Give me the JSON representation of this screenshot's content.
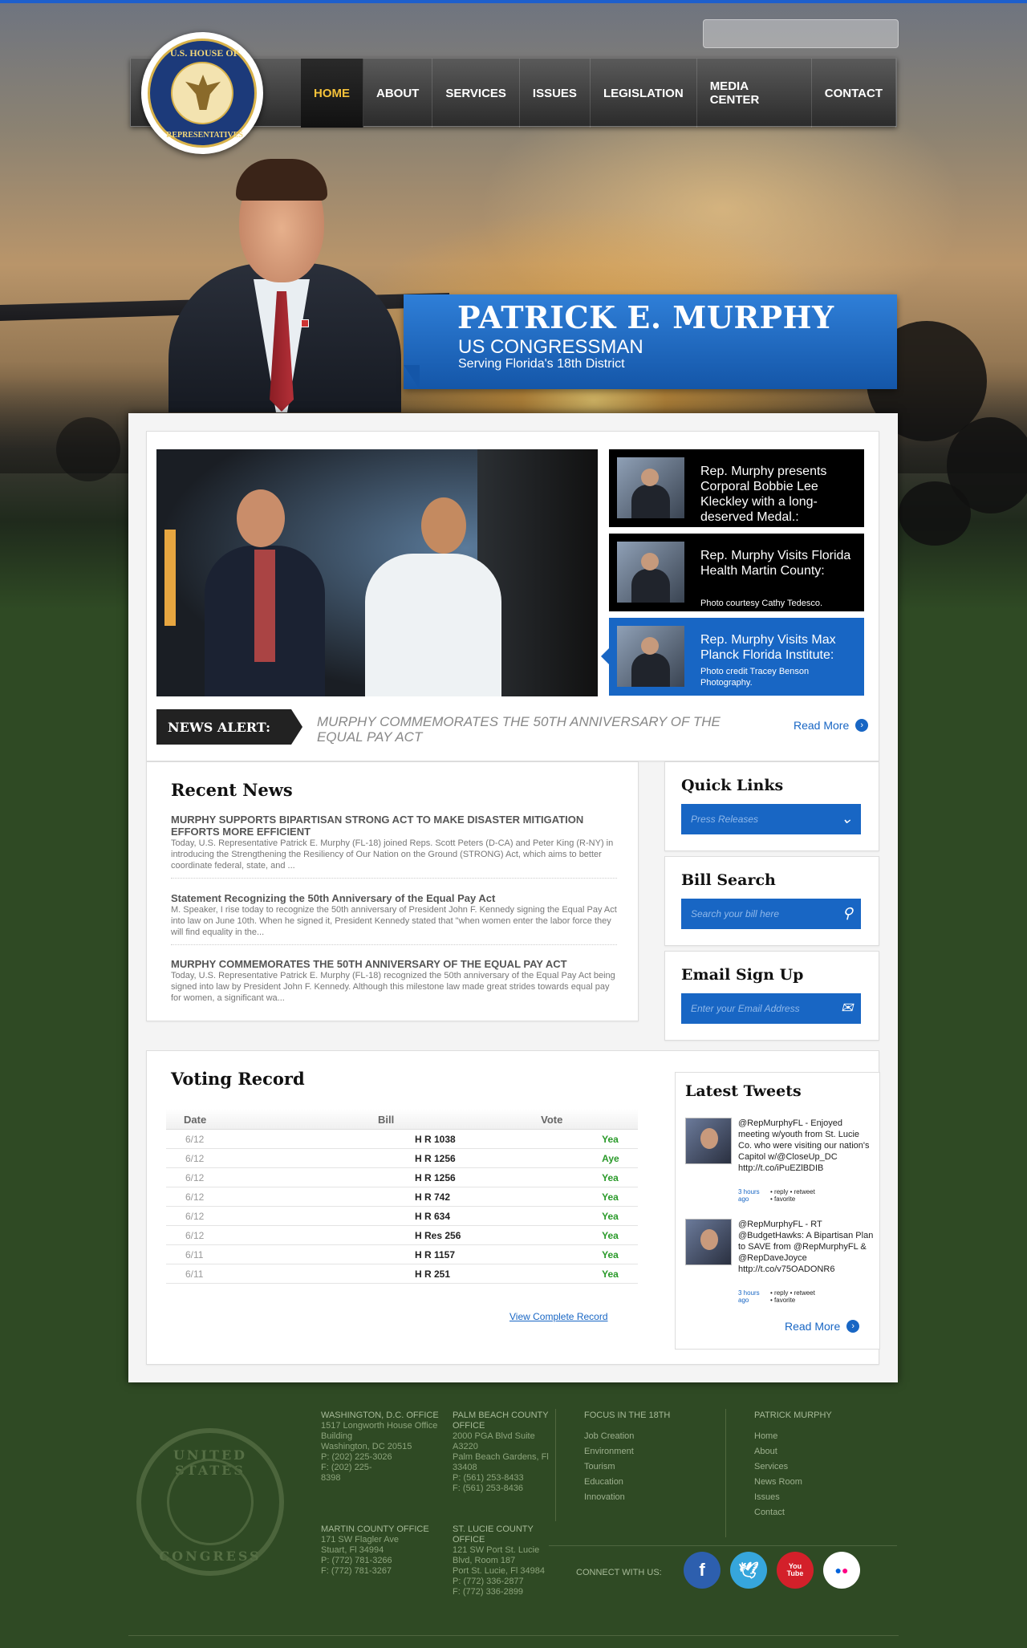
{
  "nav": {
    "items": [
      "HOME",
      "ABOUT",
      "SERVICES",
      "ISSUES",
      "LEGISLATION",
      "MEDIA CENTER",
      "CONTACT"
    ],
    "active": "HOME"
  },
  "seal": {
    "top_text": "U.S. HOUSE OF",
    "bottom_text": "REPRESENTATIVES"
  },
  "hero": {
    "name": "PATRICK E. MURPHY",
    "role": "US CONGRESSMAN",
    "district": "Serving Florida's 18th District"
  },
  "slides": [
    {
      "title": "Rep. Murphy presents Corporal Bobbie Lee Kleckley with a long-deserved Medal.:",
      "credit": ""
    },
    {
      "title": "Rep. Murphy Visits Florida Health Martin County:",
      "credit": "Photo courtesy Cathy Tedesco."
    },
    {
      "title": "Rep. Murphy Visits Max Planck Florida Institute:",
      "credit": "Photo credit Tracey Benson Photography."
    }
  ],
  "news_alert": {
    "label": "NEWS ALERT:",
    "text": "MURPHY COMMEMORATES THE 50TH ANNIVERSARY OF THE EQUAL PAY ACT",
    "read_more": "Read More"
  },
  "recent_news": {
    "title": "Recent News",
    "items": [
      {
        "title": "MURPHY SUPPORTS BIPARTISAN STRONG ACT TO MAKE DISASTER MITIGATION EFFORTS MORE EFFICIENT",
        "body": "Today, U.S. Representative Patrick E. Murphy (FL-18) joined Reps. Scott Peters (D-CA) and Peter King (R-NY) in introducing the Strengthening the Resiliency of Our Nation on the Ground (STRONG) Act, which aims to better coordinate federal, state, and ..."
      },
      {
        "title": "Statement Recognizing the 50th Anniversary of the Equal Pay Act",
        "body": "M. Speaker, I rise today to recognize the 50th anniversary of President John F. Kennedy signing the Equal Pay Act into law on June 10th. When he signed it, President Kennedy stated that \"when women enter the labor force they will find equality in the..."
      },
      {
        "title": "MURPHY COMMEMORATES THE 50TH ANNIVERSARY OF THE EQUAL PAY ACT",
        "body": "Today, U.S. Representative Patrick E. Murphy (FL-18) recognized the 50th anniversary of the Equal Pay Act being signed into law by President John F. Kennedy. Although this milestone law made great strides towards equal pay for women, a significant wa..."
      }
    ]
  },
  "quick_links": {
    "title": "Quick Links",
    "selected": "Press Releases"
  },
  "bill_search": {
    "title": "Bill Search",
    "placeholder": "Search your bill here"
  },
  "email_signup": {
    "title": "Email Sign Up",
    "placeholder": "Enter your Email Address"
  },
  "voting_record": {
    "title": "Voting Record",
    "columns": [
      "Date",
      "Bill",
      "Vote"
    ],
    "rows": [
      [
        "6/12",
        "H R 1038",
        "Yea"
      ],
      [
        "6/12",
        "H R 1256",
        "Aye"
      ],
      [
        "6/12",
        "H R 1256",
        "Yea"
      ],
      [
        "6/12",
        "H R 742",
        "Yea"
      ],
      [
        "6/12",
        "H R 634",
        "Yea"
      ],
      [
        "6/12",
        "H Res 256",
        "Yea"
      ],
      [
        "6/11",
        "H R 1157",
        "Yea"
      ],
      [
        "6/11",
        "H R 251",
        "Yea"
      ]
    ],
    "link": "View Complete Record"
  },
  "tweets": {
    "title": "Latest Tweets",
    "items": [
      {
        "text": "@RepMurphyFL - Enjoyed meeting w/youth from St. Lucie Co. who were visiting our nation's Capitol w/@CloseUp_DC http://t.co/iPuEZlBDIB",
        "time": "3 hours ago",
        "actions": [
          "• reply • retweet",
          "• favorite"
        ]
      },
      {
        "text": "@RepMurphyFL - RT @BudgetHawks: A Bipartisan Plan to SAVE from @RepMurphyFL & @RepDaveJoyce http://t.co/v75OADONR6",
        "time": "3 hours ago",
        "actions": [
          "• reply • retweet",
          "• favorite"
        ]
      }
    ],
    "read_more": "Read More"
  },
  "footer": {
    "seal_top": "UNITED STATES",
    "seal_bottom": "CONGRESS",
    "offices": [
      {
        "lines": [
          "WASHINGTON, D.C. OFFICE",
          "1517 Longworth House Office",
          "Building",
          "Washington, DC 20515",
          "P:  (202) 225-3026",
          "F:  (202) 225-",
          "8398"
        ]
      },
      {
        "lines": [
          "PALM BEACH COUNTY",
          "OFFICE",
          "2000 PGA Blvd Suite",
          "A3220",
          "Palm Beach Gardens, Fl",
          "33408",
          "P:  (561) 253-8433",
          "F:  (561) 253-8436"
        ]
      },
      {
        "lines": [
          "MARTIN COUNTY OFFICE",
          "171 SW Flagler Ave",
          "Stuart, Fl 34994",
          "P:  (772) 781-3266",
          "F:  (772) 781-3267"
        ]
      },
      {
        "lines": [
          "ST. LUCIE COUNTY",
          "OFFICE",
          "121 SW Port St. Lucie",
          "Blvd, Room 187",
          "Port St. Lucie, Fl 34984",
          "P:  (772) 336-2877",
          "F:  (772) 336-2899"
        ]
      }
    ],
    "focus": {
      "title": "FOCUS IN THE 18TH",
      "links": [
        "Job Creation",
        "Environment",
        "Tourism",
        "Education",
        "Innovation"
      ]
    },
    "menu": {
      "title": "PATRICK MURPHY",
      "links": [
        "Home",
        "About",
        "Services",
        "News Room",
        "Issues",
        "Contact"
      ]
    },
    "connect": "CONNECT WITH US:",
    "social": [
      {
        "icon": "facebook-icon",
        "glyph": "f",
        "color": "#2d5fae"
      },
      {
        "icon": "twitter-icon",
        "glyph": "🕊",
        "color": "#36a6dc"
      },
      {
        "icon": "youtube-icon",
        "glyph": "You Tube",
        "color": "#d3202a"
      },
      {
        "icon": "flickr-icon",
        "glyph": "••",
        "color": "#ffffff"
      }
    ]
  }
}
